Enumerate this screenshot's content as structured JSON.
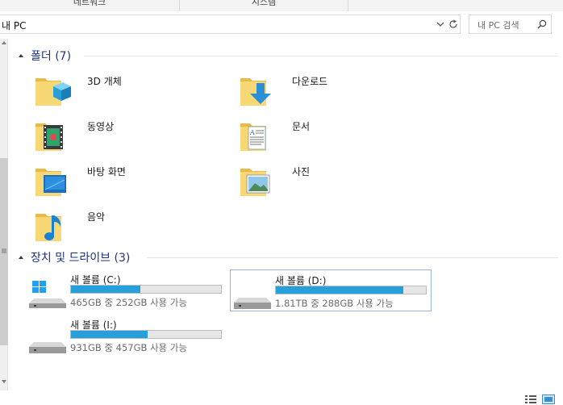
{
  "ribbon": {
    "tab_network": "네트워크",
    "tab_system": "시스템"
  },
  "address": {
    "path": "내 PC"
  },
  "search": {
    "placeholder": "내 PC 검색"
  },
  "sections": {
    "folders": {
      "title": "폴더 (7)"
    },
    "drives": {
      "title": "장치 및 드라이브 (3)"
    }
  },
  "folders": [
    {
      "label": "3D 개체",
      "icon": "3d-objects-folder-icon"
    },
    {
      "label": "다운로드",
      "icon": "downloads-folder-icon"
    },
    {
      "label": "동영상",
      "icon": "videos-folder-icon"
    },
    {
      "label": "문서",
      "icon": "documents-folder-icon"
    },
    {
      "label": "바탕 화면",
      "icon": "desktop-folder-icon"
    },
    {
      "label": "사진",
      "icon": "pictures-folder-icon"
    },
    {
      "label": "음악",
      "icon": "music-folder-icon"
    }
  ],
  "drives": [
    {
      "label": "새 볼륨 (C:)",
      "free": "465GB 중 252GB 사용 가능",
      "used_fraction": 0.46,
      "icon": "windows-drive-icon"
    },
    {
      "label": "새 볼륨 (D:)",
      "free": "1.81TB 중 288GB 사용 가능",
      "used_fraction": 0.85,
      "icon": "hard-drive-icon"
    },
    {
      "label": "새 볼륨 (I:)",
      "free": "931GB 중 457GB 사용 가능",
      "used_fraction": 0.51,
      "icon": "hard-drive-icon"
    }
  ],
  "colors": {
    "section_title": "#1e3287",
    "drive_fill": "#26a0da",
    "folder_yellow": "#f8d775"
  }
}
